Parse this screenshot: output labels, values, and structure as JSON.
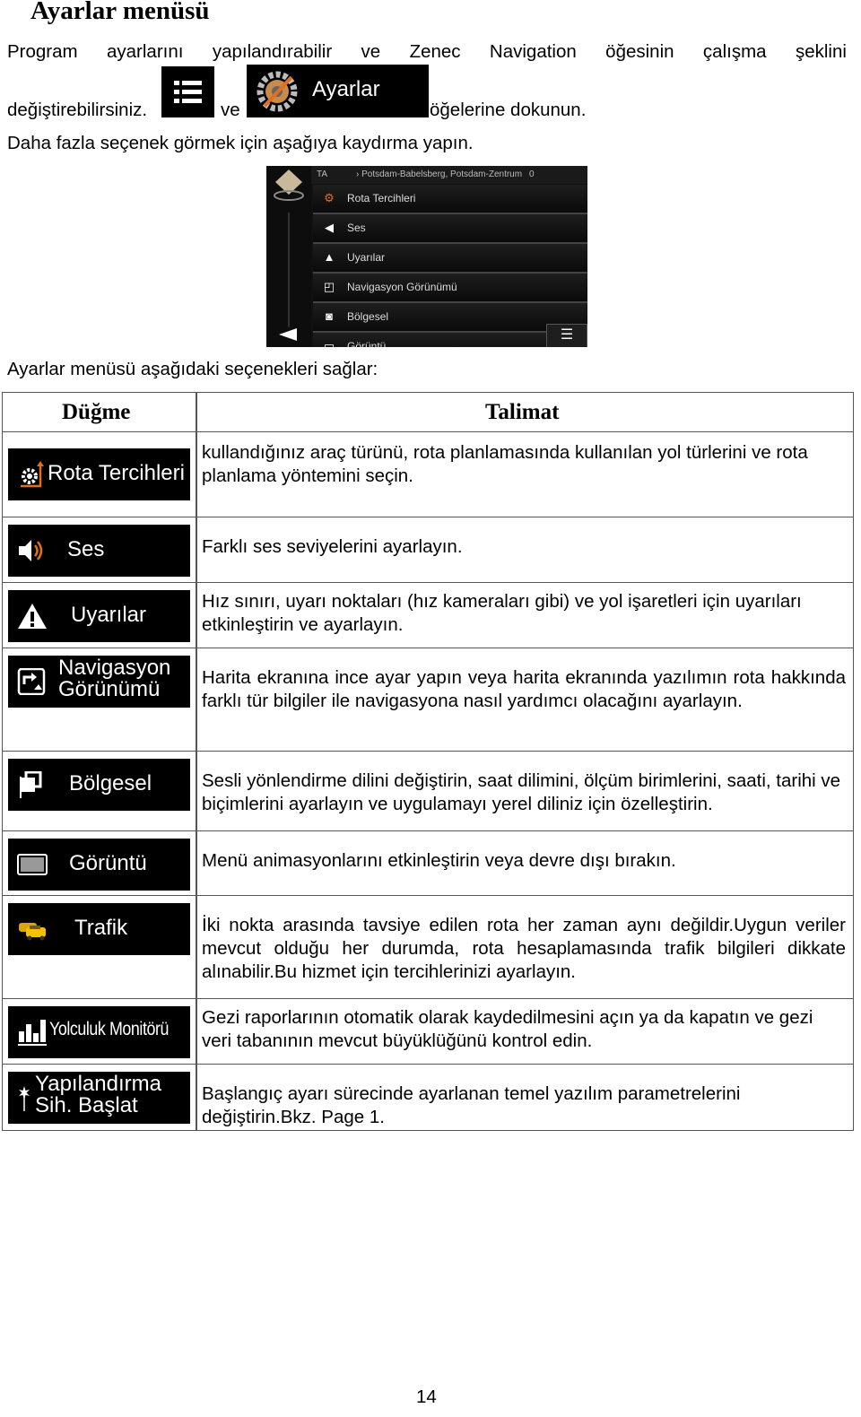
{
  "title": "Ayarlar menüsü",
  "intro": {
    "line1_words": [
      "Program",
      "ayarlarını",
      "yapılandırabilir",
      "ve",
      "Zenec",
      "Navigation",
      "öğesinin",
      "çalışma",
      "şeklini"
    ],
    "line2_a": "değiştirebilirsiniz.",
    "line2_b": "ve",
    "line2_c": "öğelerine dokunun.",
    "menu_icon": "menu-list-icon",
    "settings_button_label": "Ayarlar",
    "line3": "Daha fazla seçenek görmek için aşağıya kaydırma yapın."
  },
  "screenshot": {
    "top_left": "TA",
    "top_location": "› Potsdam-Babelsberg, Potsdam-Zentrum",
    "top_value": "0",
    "items": [
      {
        "label": "Rota Tercihleri",
        "icon": "gear-route-icon"
      },
      {
        "label": "Ses",
        "icon": "speaker-icon"
      },
      {
        "label": "Uyarılar",
        "icon": "warning-icon"
      },
      {
        "label": "Navigasyon Görünümü",
        "icon": "nav-view-icon"
      },
      {
        "label": "Bölgesel",
        "icon": "flag-icon"
      },
      {
        "label": "Görüntü",
        "icon": "display-icon"
      }
    ]
  },
  "table_intro": "Ayarlar menüsü aşağıdaki seçenekleri sağlar:",
  "table": {
    "headers": [
      "Düğme",
      "Talimat"
    ],
    "rows": [
      {
        "button": "Rota Tercihleri",
        "icon": "gear-route-icon",
        "text": "kullandığınız araç türünü, rota planlamasında kullanılan yol türlerini ve rota planlama yöntemini seçin."
      },
      {
        "button": "Ses",
        "icon": "speaker-icon",
        "text": "Farklı ses seviyelerini ayarlayın."
      },
      {
        "button": "Uyarılar",
        "icon": "warning-icon",
        "text": "Hız sınırı, uyarı noktaları (hız kameraları gibi) ve yol işaretleri için uyarıları etkinleştirin ve ayarlayın."
      },
      {
        "button": "Navigasyon",
        "button2": "Görünümü",
        "icon": "nav-view-icon",
        "text": "Harita ekranına ince ayar yapın veya harita ekranında yazılımın rota hakkında farklı tür bilgiler ile navigasyona nasıl yardımcı olacağını ayarlayın."
      },
      {
        "button": "Bölgesel",
        "icon": "flag-icon",
        "text": "Sesli yönlendirme dilini değiştirin, saat dilimini, ölçüm birimlerini, saati, tarihi ve biçimlerini ayarlayın ve uygulamayı yerel diliniz için özelleştirin."
      },
      {
        "button": "Görüntü",
        "icon": "display-icon",
        "text": "Menü animasyonlarını etkinleştirin veya devre dışı bırakın."
      },
      {
        "button": "Trafik",
        "icon": "traffic-cars-icon",
        "text": "İki nokta arasında tavsiye edilen rota her zaman aynı değildir.Uygun veriler mevcut olduğu her durumda, rota hesaplamasında trafik bilgileri dikkate alınabilir.Bu hizmet için tercihlerinizi ayarlayın."
      },
      {
        "button": "Yolculuk Monitörü",
        "icon": "bar-chart-icon",
        "text": "Gezi raporlarının otomatik olarak kaydedilmesini açın ya da kapatın ve gezi veri tabanının mevcut büyüklüğünü kontrol edin."
      },
      {
        "button": "Yapılandırma",
        "button2": "Sih. Başlat",
        "icon": "magic-wand-icon",
        "text": "Başlangıç ayarı sürecinde ayarlanan temel yazılım parametrelerini değiştirin.Bkz. Page 1."
      }
    ]
  },
  "page_number": "14",
  "colors": {
    "accent_orange": "#e07020",
    "button_bg": "#000000"
  }
}
